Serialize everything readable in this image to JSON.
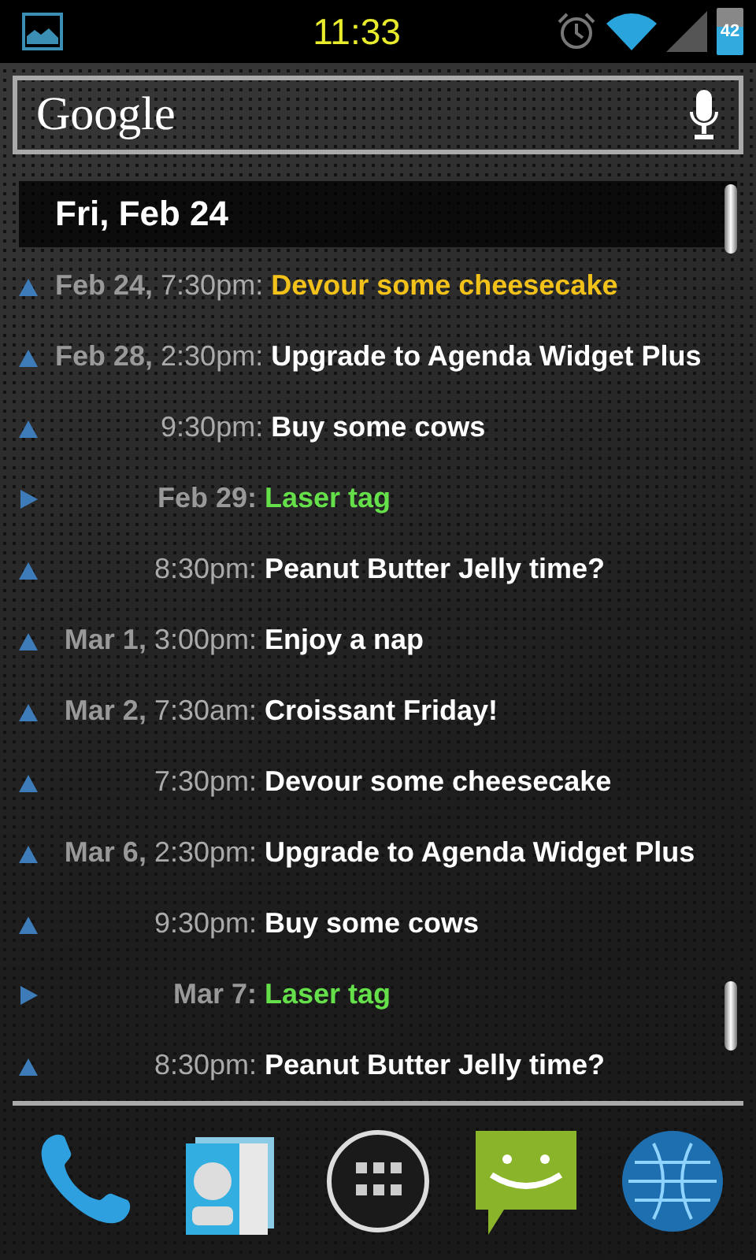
{
  "status_bar": {
    "time": "11:33",
    "battery": "42"
  },
  "search": {
    "logo": "Google"
  },
  "agenda": {
    "header": "Fri, Feb 24",
    "days": [
      {
        "events": [
          {
            "kind": "timed",
            "date": "Feb 24,",
            "time": "7:30pm:",
            "title": "Devour some cheesecake",
            "color": "#f2c21b"
          }
        ]
      },
      {
        "events": [
          {
            "kind": "timed",
            "date": "Feb 28,",
            "time": "2:30pm:",
            "title": "Upgrade to Agenda Widget Plus",
            "color": "#ffffff"
          },
          {
            "kind": "timed",
            "time": "9:30pm:",
            "title": "Buy some cows",
            "color": "#ffffff"
          }
        ]
      },
      {
        "events": [
          {
            "kind": "all_day",
            "date": "Feb 29:",
            "title": "Laser tag",
            "color": "#66e04a"
          },
          {
            "kind": "timed",
            "time": "8:30pm:",
            "title": "Peanut Butter Jelly time?",
            "color": "#ffffff"
          }
        ]
      },
      {
        "events": [
          {
            "kind": "timed",
            "date": "Mar 1,",
            "time": "3:00pm:",
            "title": "Enjoy a nap",
            "color": "#ffffff"
          }
        ]
      },
      {
        "events": [
          {
            "kind": "timed",
            "date": "Mar 2,",
            "time": "7:30am:",
            "title": "Croissant Friday!",
            "color": "#ffffff"
          },
          {
            "kind": "timed",
            "time": "7:30pm:",
            "title": "Devour some cheesecake",
            "color": "#ffffff"
          }
        ]
      },
      {
        "events": [
          {
            "kind": "timed",
            "date": "Mar 6,",
            "time": "2:30pm:",
            "title": "Upgrade to Agenda Widget Plus",
            "color": "#ffffff"
          },
          {
            "kind": "timed",
            "time": "9:30pm:",
            "title": "Buy some cows",
            "color": "#ffffff"
          }
        ]
      },
      {
        "events": [
          {
            "kind": "all_day",
            "date": "Mar 7:",
            "title": "Laser tag",
            "color": "#66e04a"
          },
          {
            "kind": "timed",
            "time": "8:30pm:",
            "title": "Peanut Butter Jelly time?",
            "color": "#ffffff"
          }
        ]
      }
    ]
  }
}
